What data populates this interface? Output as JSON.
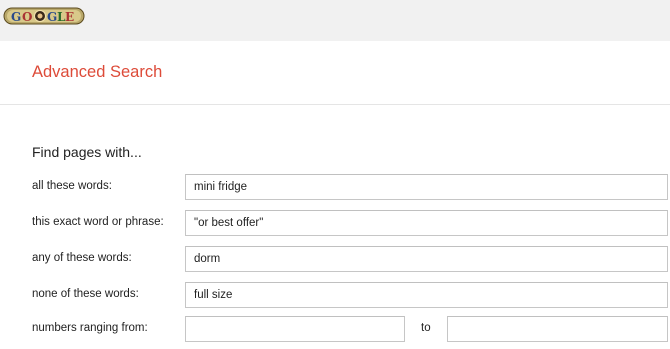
{
  "logo": {
    "text": "GOOGLE"
  },
  "page": {
    "title": "Advanced Search"
  },
  "section": {
    "heading": "Find pages with..."
  },
  "rows": [
    {
      "label": "all these words:",
      "value": "mini fridge"
    },
    {
      "label": "this exact word or phrase:",
      "value": "\"or best offer\""
    },
    {
      "label": "any of these words:",
      "value": "dorm"
    },
    {
      "label": "none of these words:",
      "value": "full size"
    },
    {
      "label": "numbers ranging from:",
      "value": "",
      "to_value": "",
      "to_label": "to"
    }
  ],
  "colors": {
    "title": "#dd4b39",
    "topbar": "#f1f1f1",
    "field_border": "#c6c6c6"
  }
}
